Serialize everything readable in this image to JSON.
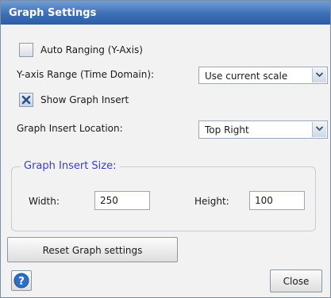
{
  "window": {
    "title": "Graph Settings"
  },
  "auto_ranging": {
    "label": "Auto Ranging (Y-Axis)",
    "checked": false
  },
  "y_axis_range": {
    "label": "Y-axis Range (Time Domain):",
    "value": "Use current scale"
  },
  "show_insert": {
    "label": "Show Graph Insert",
    "checked": true
  },
  "insert_location": {
    "label": "Graph Insert Location:",
    "value": "Top Right"
  },
  "insert_size": {
    "title": "Graph Insert Size:",
    "width_label": "Width:",
    "width_value": "250",
    "height_label": "Height:",
    "height_value": "100"
  },
  "buttons": {
    "reset": "Reset Graph settings",
    "close": "Close"
  },
  "icons": {
    "help": "help-icon",
    "check": "check-x-icon",
    "dropdown": "chevron-down-icon"
  },
  "colors": {
    "title_bar": "#3d6fb5",
    "group_title": "#3c3ccc",
    "help_icon": "#2f6fc2"
  }
}
